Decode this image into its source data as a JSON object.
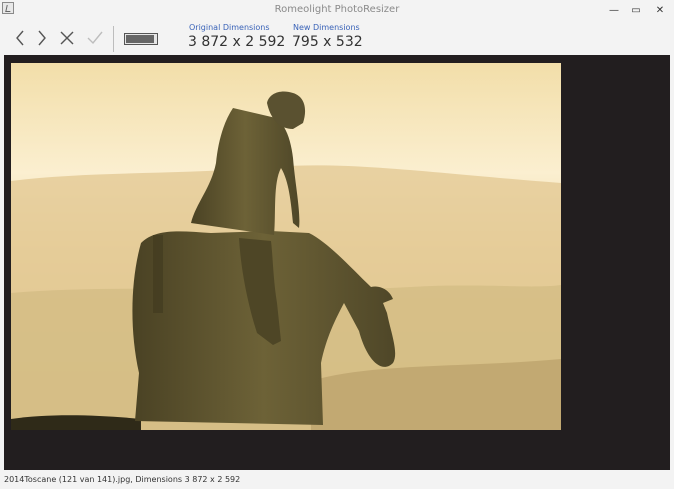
{
  "window": {
    "title": "Romeolight PhotoResizer",
    "controls": {
      "minimize": "—",
      "maximize": "▭",
      "close": "✕"
    }
  },
  "toolbar": {
    "icons": [
      "chevron-left-icon",
      "chevron-right-icon",
      "close-icon",
      "check-icon"
    ],
    "quality_level": 0.92,
    "original_label": "Original Dimensions",
    "original_value": "3 872 x 2 592",
    "new_label": "New Dimensions",
    "new_value": "795 x 532"
  },
  "colors": {
    "viewer_background": "#221e1f",
    "label_blue": "#3a63b8",
    "photo_sky": "#f3e0b2",
    "statue": "#5f5530"
  },
  "status": {
    "text": "2014Toscane (121 van 141).jpg, Dimensions 3 872 x 2 592"
  }
}
